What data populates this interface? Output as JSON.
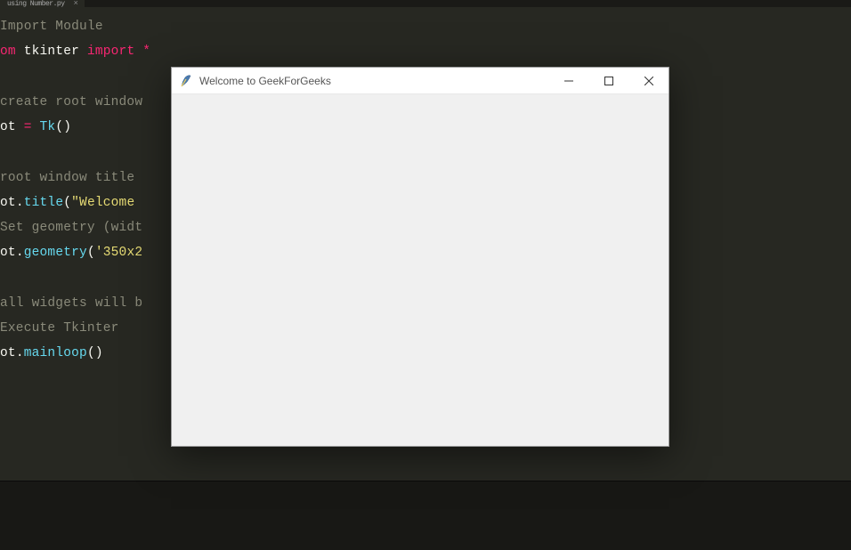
{
  "editor": {
    "tab": {
      "name": "using Number.py",
      "close": "×"
    },
    "code": {
      "l1_comment": "Import Module",
      "l2_from": "om ",
      "l2_module": "tkinter",
      "l2_import": " import ",
      "l2_star": "*",
      "l3_comment": "create root window",
      "l4_var": "ot ",
      "l4_eq": "= ",
      "l4_tk": "Tk",
      "l4_paren": "()",
      "l5_comment": "root window title ",
      "l6_var": "ot",
      "l6_dot": ".",
      "l6_title": "title",
      "l6_open": "(",
      "l6_str": "\"Welcome ",
      "l7_comment": "Set geometry (widt",
      "l8_var": "ot",
      "l8_dot": ".",
      "l8_geom": "geometry",
      "l8_open": "(",
      "l8_str": "'350x2",
      "l9_comment": "all widgets will b",
      "l10_comment": "Execute Tkinter",
      "l11_var": "ot",
      "l11_dot": ".",
      "l11_main": "mainloop",
      "l11_paren": "()"
    }
  },
  "tkwindow": {
    "title": "Welcome to GeekForGeeks"
  }
}
